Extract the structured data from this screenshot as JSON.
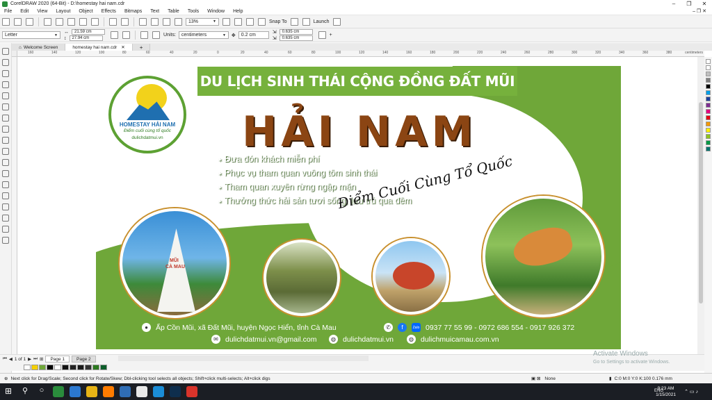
{
  "window": {
    "title": "CorelDRAW 2020 (64-Bit) - D:\\homestay hai nam.cdr"
  },
  "menu": [
    "File",
    "Edit",
    "View",
    "Layout",
    "Object",
    "Effects",
    "Bitmaps",
    "Text",
    "Table",
    "Tools",
    "Window",
    "Help"
  ],
  "toolbar": {
    "zoom": "13%",
    "snap": "Snap To",
    "launch": "Launch"
  },
  "propbar": {
    "page_size": "Letter",
    "width": "21.59 cm",
    "height": "27.94 cm",
    "units_label": "Units:",
    "units": "centimeters",
    "nudge": "0.2 cm",
    "dup_x": "0.635 cm",
    "dup_y": "0.635 cm"
  },
  "tabs": [
    {
      "label": "Welcome Screen"
    },
    {
      "label": "homestay hai nam.cdr"
    }
  ],
  "ruler": {
    "unit": "centimeters",
    "ticks": [
      "160",
      "140",
      "120",
      "100",
      "80",
      "60",
      "40",
      "20",
      "0",
      "20",
      "40",
      "60",
      "80",
      "100",
      "120",
      "140",
      "160",
      "180",
      "200",
      "220",
      "240",
      "260",
      "280",
      "300",
      "320",
      "340",
      "360",
      "380"
    ]
  },
  "artwork": {
    "banner": "DU LỊCH SINH THÁI CỘNG ĐỒNG ĐẤT MŨI",
    "title": "HẢI NAM",
    "bullets": [
      "Đưa đón khách miễn phí",
      "Phục vụ tham quan vuông tôm sinh thái",
      "Tham quan xuyên rừng ngập mặn",
      "Thưởng thức hải sản tươi sống, lưu trú qua đêm"
    ],
    "slogan": "Điểm Cuối Cùng Tổ Quốc",
    "logo": {
      "line1": "HOMESTAY HẢI NAM",
      "line2": "Điểm cuối cùng tổ quốc",
      "line3": "dulichdatmui.vn"
    },
    "monument": {
      "line1": "MŨI",
      "line2": "CÀ MAU"
    },
    "address": "Ấp Cồn Mũi, xã Đất Mũi, huyện Ngọc Hiển, tỉnh Cà Mau",
    "phones": "0937 77 55 99 - 0972 686 554 - 0917 926 372",
    "email": "dulichdatmui.vn@gmail.com",
    "web1": "dulichdatmui.vn",
    "web2": "dulichmuicamau.com.vn",
    "zalo": "Zalo"
  },
  "pages": {
    "nav": "1 of 1",
    "page1": "Page 1",
    "page2": "Page 2"
  },
  "status": {
    "hint": "Next click for Drag/Scale; Second click for Rotate/Skew; Dbl-clicking tool selects all objects; Shift+click multi-selects; Alt+click digs",
    "fill": "None",
    "outline": "C:0 M:0 Y:0 K:100  0.176 mm"
  },
  "activate": {
    "line1": "Activate Windows",
    "line2": "Go to Settings to activate Windows."
  },
  "taskbar": {
    "time": "9:23 AM",
    "date": "1/15/2021",
    "lang": "ENG"
  },
  "colors": {
    "accent": "#6fa739",
    "brown": "#8b4513",
    "taskbar": "#1b1e24"
  }
}
